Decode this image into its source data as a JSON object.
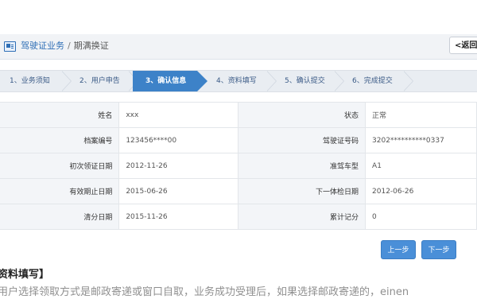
{
  "breadcrumb": {
    "root": "驾驶证业务",
    "separator": "/",
    "current": "期满换证"
  },
  "back_button": "<返回",
  "steps": [
    {
      "label": "1、业务须知",
      "active": false
    },
    {
      "label": "2、用户申告",
      "active": false
    },
    {
      "label": "3、确认信息",
      "active": true
    },
    {
      "label": "4、资料填写",
      "active": false
    },
    {
      "label": "5、确认提交",
      "active": false
    },
    {
      "label": "6、完成提交",
      "active": false
    }
  ],
  "info_rows": [
    {
      "l1": "姓名",
      "v1": "xxx",
      "l2": "状态",
      "v2": "正常"
    },
    {
      "l1": "档案编号",
      "v1": "123456****00",
      "l2": "驾驶证号码",
      "v2": "3202**********0337"
    },
    {
      "l1": "初次领证日期",
      "v1": "2012-11-26",
      "l2": "准驾车型",
      "v2": "A1"
    },
    {
      "l1": "有效期止日期",
      "v1": "2015-06-26",
      "l2": "下一体检日期",
      "v2": "2012-06-26"
    },
    {
      "l1": "清分日期",
      "v1": "2015-11-26",
      "l2": "累计记分",
      "v2": "0"
    }
  ],
  "buttons": {
    "prev": "上一步",
    "next": "下一步"
  },
  "section_title": "资料填写】",
  "paragraph": "用户选择领取方式是邮政寄递或窗口自取，业务成功受理后，如果选择邮政寄递的，einen"
}
